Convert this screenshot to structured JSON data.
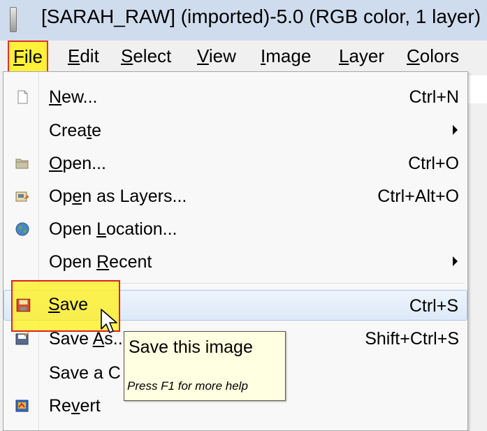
{
  "window": {
    "title": "[SARAH_RAW] (imported)-5.0 (RGB color, 1 layer)"
  },
  "menubar": {
    "items": [
      "File",
      "Edit",
      "Select",
      "View",
      "Image",
      "Layer",
      "Colors"
    ],
    "active": "File"
  },
  "file_menu": {
    "items": [
      {
        "pre": "",
        "ul": "N",
        "post": "ew...",
        "shortcut": "Ctrl+N",
        "icon": "new-document-icon"
      },
      {
        "pre": "Crea",
        "ul": "t",
        "post": "e",
        "shortcut": "",
        "submenu": true
      },
      {
        "pre": "",
        "ul": "O",
        "post": "pen...",
        "shortcut": "Ctrl+O",
        "icon": "folder-icon"
      },
      {
        "pre": "Op",
        "ul": "e",
        "post": "n as Layers...",
        "shortcut": "Ctrl+Alt+O",
        "icon": "open-layers-icon"
      },
      {
        "pre": "Open ",
        "ul": "L",
        "post": "ocation...",
        "shortcut": "",
        "icon": "globe-icon"
      },
      {
        "pre": "Open ",
        "ul": "R",
        "post": "ecent",
        "shortcut": "",
        "submenu": true
      },
      {
        "pre": "",
        "ul": "S",
        "post": "ave",
        "shortcut": "Ctrl+S",
        "icon": "save-icon",
        "highlighted": true
      },
      {
        "pre": "Save ",
        "ul": "A",
        "post": "s...",
        "shortcut": "Shift+Ctrl+S",
        "icon": "save-as-icon"
      },
      {
        "pre": "Save a C",
        "ul": "",
        "post": "",
        "shortcut": ""
      },
      {
        "pre": "Re",
        "ul": "v",
        "post": "ert",
        "shortcut": "",
        "icon": "revert-icon"
      }
    ]
  },
  "tooltip": {
    "title": "Save this image",
    "hint": "Press F1 for more help"
  },
  "colors": {
    "highlight_yellow": "#fff03a",
    "highlight_border": "#e03030",
    "tooltip_bg": "#ffffe1",
    "titlebar_bg": "#cfdced"
  }
}
